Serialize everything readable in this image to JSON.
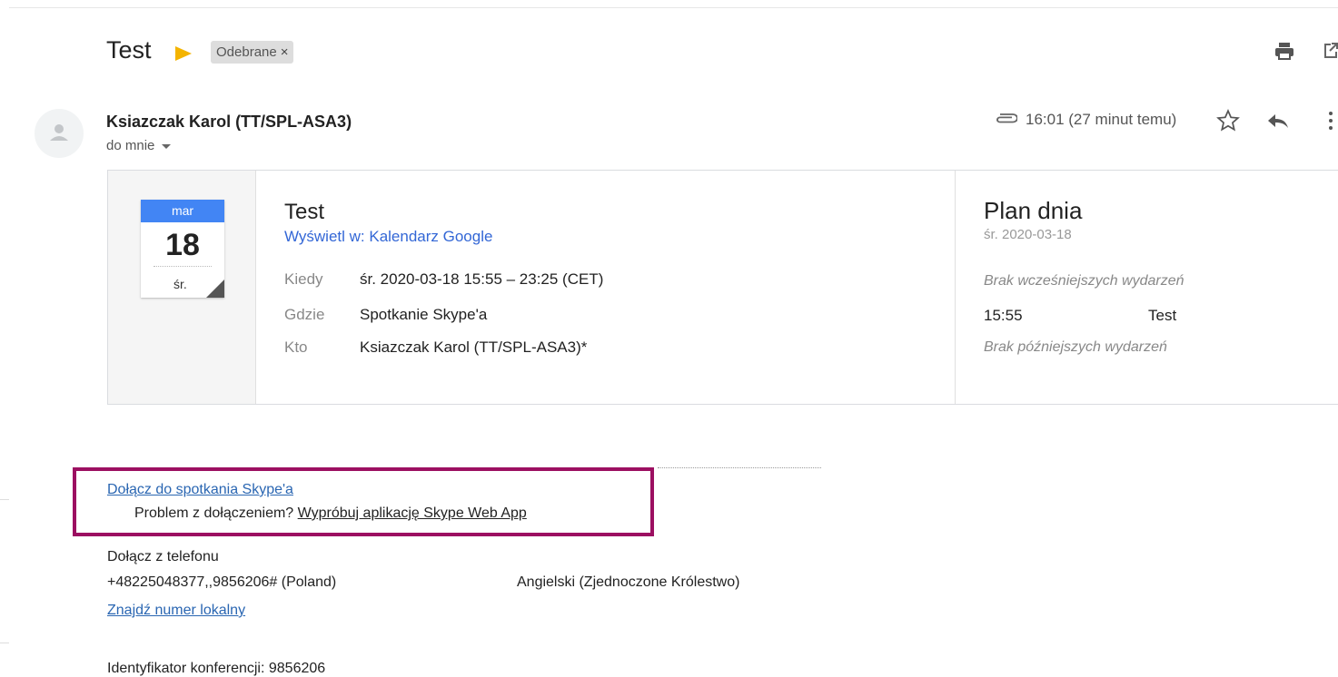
{
  "header": {
    "subject": "Test",
    "label_chip": "Odebrane",
    "chip_close": "×"
  },
  "sender": {
    "name": "Ksiazczak Karol (TT/SPL-ASA3)",
    "to": "do mnie",
    "time": "16:01 (27 minut temu)"
  },
  "invite": {
    "month": "mar",
    "day": "18",
    "weekday": "śr.",
    "title": "Test",
    "view_link": "Wyświetl w: Kalendarz Google",
    "rows": [
      {
        "label": "Kiedy",
        "value": "śr. 2020-03-18 15:55 – 23:25 (CET)"
      },
      {
        "label": "Gdzie",
        "value": "Spotkanie Skype'a"
      },
      {
        "label": "Kto",
        "value": "Ksiazczak Karol (TT/SPL-ASA3)*"
      }
    ],
    "plan": {
      "title": "Plan dnia",
      "date": "śr. 2020-03-18",
      "no_earlier": "Brak wcześniejszych wydarzeń",
      "event_time": "15:55",
      "event_name": "Test",
      "no_later": "Brak późniejszych wydarzeń"
    }
  },
  "body": {
    "join_link": "Dołącz do spotkania Skype'a",
    "problem_text": "Problem z dołączeniem?",
    "webapp_link": "Wypróbuj aplikację Skype Web App",
    "phone_heading": "Dołącz z telefonu",
    "phone_number": "+48225048377,,9856206# (Poland)",
    "phone_language": "Angielski (Zjednoczone Królestwo)",
    "find_local": "Znajdź numer lokalny",
    "conference_id": "Identyfikator konferencji: 9856206"
  },
  "colors": {
    "accent_blue": "#4285f4",
    "label_arrow": "#f4b400",
    "highlight_box": "#9c0f61",
    "link": "#2a66b2"
  },
  "icons": [
    "print-icon",
    "popout-icon",
    "avatar-icon",
    "attachment-icon",
    "star-icon",
    "reply-icon",
    "more-vert-icon",
    "chevron-down-icon"
  ]
}
